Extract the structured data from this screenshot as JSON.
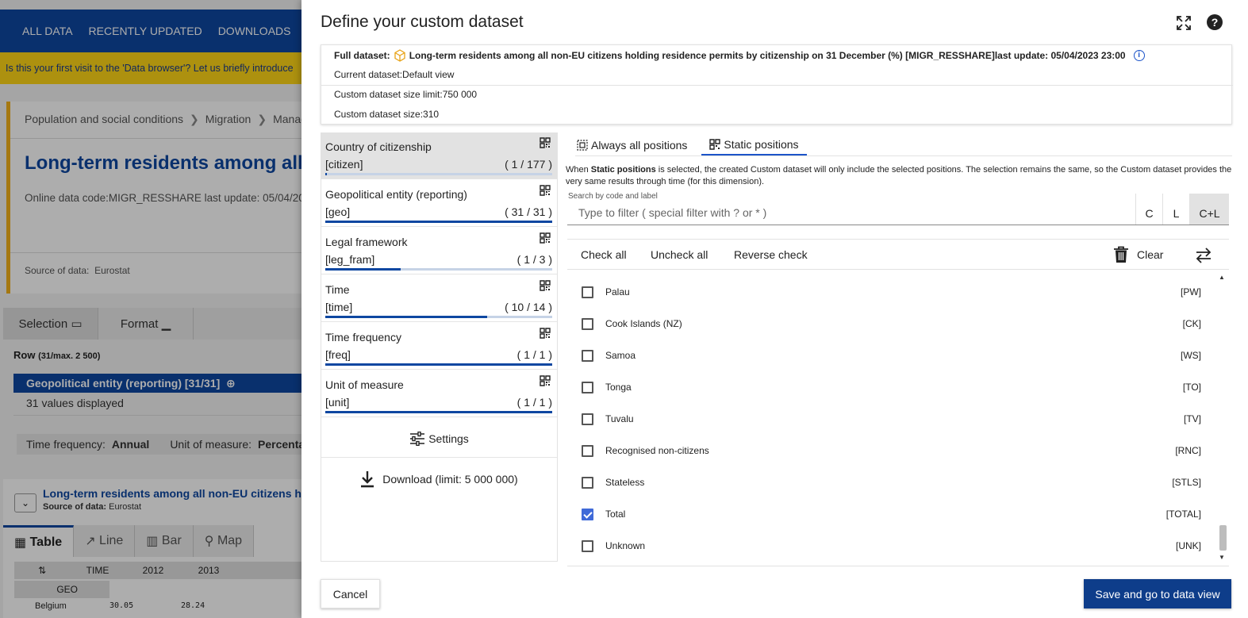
{
  "background": {
    "nav": [
      "ALL DATA",
      "RECENTLY UPDATED",
      "DOWNLOADS"
    ],
    "banner": "Is this your first visit to the 'Data browser'? Let us briefly introduce",
    "breadcrumb": [
      "Population and social conditions",
      "Migration",
      "Manag"
    ],
    "title": "Long-term residents among all no",
    "online_code_label": "Online data code:",
    "online_code": "MIGR_RESSHARE",
    "last_update_text": "last update: 05/04/20",
    "source_label": "Source of data:",
    "source": "Eurostat",
    "tabs": [
      "Selection",
      "Format"
    ],
    "row_label": "Row",
    "row_count": "(31/max. 2 500)",
    "geo_chip": "Geopolitical entity (reporting) [31/31]",
    "values_displayed": "31 values displayed",
    "time_frequency_label": "Time frequency:",
    "time_frequency_value": "Annual",
    "unit_label": "Unit of measure:",
    "unit_value": "Percenta",
    "table_title": "Long-term residents among all non-EU citizens hold",
    "table_source_label": "Source of data:",
    "table_source": "Eurostat",
    "view_tabs": [
      "Table",
      "Line",
      "Bar",
      "Map"
    ],
    "time_header": "TIME",
    "years": [
      "2012",
      "2013"
    ],
    "geo_header": "GEO",
    "first_row": {
      "label": "Belgium",
      "v2012": "30.05",
      "v2013": "28.24"
    }
  },
  "dialog": {
    "title": "Define your custom dataset",
    "full_dataset_label": "Full dataset:",
    "full_dataset_name": "Long-term residents among all non-EU citizens holding residence permits by citizenship on 31 December (%) [MIGR_RESSHARE]",
    "full_dataset_update": "last update: 05/04/2023 23:00",
    "current_dataset": "Current dataset:Default view",
    "size_limit": "Custom dataset size limit:750 000",
    "size": "Custom dataset size:310",
    "dimensions": [
      {
        "name": "Country of citizenship",
        "code": "[citizen]",
        "count": "( 1 / 177 )",
        "fill": 0.006
      },
      {
        "name": "Geopolitical entity (reporting)",
        "code": "[geo]",
        "count": "( 31 / 31 )",
        "fill": 1.0
      },
      {
        "name": "Legal framework",
        "code": "[leg_fram]",
        "count": "( 1 / 3 )",
        "fill": 0.333
      },
      {
        "name": "Time",
        "code": "[time]",
        "count": "( 10 / 14 )",
        "fill": 0.714
      },
      {
        "name": "Time frequency",
        "code": "[freq]",
        "count": "( 1 / 1 )",
        "fill": 1.0
      },
      {
        "name": "Unit of measure",
        "code": "[unit]",
        "count": "( 1 / 1 )",
        "fill": 1.0
      }
    ],
    "settings_label": "Settings",
    "download_label": "Download (limit: 5 000 000)",
    "tab_always": "Always all positions",
    "tab_static": "Static positions",
    "explain_pre": "When ",
    "explain_bold": "Static positions",
    "explain_post": " is selected, the created Custom dataset will only include the selected positions. The selection remains the same, so the Custom dataset provides the very same results through time (for this dimension).",
    "search_label": "Search by code and label",
    "search_placeholder": "Type to filter ( special filter with ? or * )",
    "search_value": "",
    "display_modes": [
      "C",
      "L",
      "C+L"
    ],
    "display_mode_selected": "C+L",
    "check_all": "Check all",
    "uncheck_all": "Uncheck all",
    "reverse_check": "Reverse check",
    "clear": "Clear",
    "items": [
      {
        "label": "Palau",
        "code": "[PW]",
        "checked": false
      },
      {
        "label": "Cook Islands (NZ)",
        "code": "[CK]",
        "checked": false
      },
      {
        "label": "Samoa",
        "code": "[WS]",
        "checked": false
      },
      {
        "label": "Tonga",
        "code": "[TO]",
        "checked": false
      },
      {
        "label": "Tuvalu",
        "code": "[TV]",
        "checked": false
      },
      {
        "label": "Recognised non-citizens",
        "code": "[RNC]",
        "checked": false
      },
      {
        "label": "Stateless",
        "code": "[STLS]",
        "checked": false
      },
      {
        "label": "Total",
        "code": "[TOTAL]",
        "checked": true
      },
      {
        "label": "Unknown",
        "code": "[UNK]",
        "checked": false
      }
    ],
    "cancel": "Cancel",
    "save": "Save and go to data view",
    "colors": {
      "primary": "#0e3d8a",
      "accent": "#1c54c9",
      "checkbox": "#3f6ad8"
    }
  }
}
